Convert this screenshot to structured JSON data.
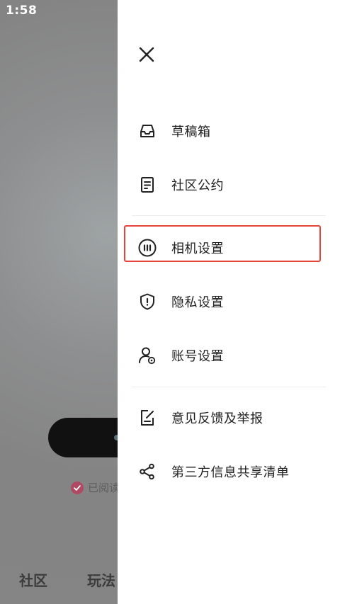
{
  "status_bar": {
    "time": "1:58"
  },
  "background_screen": {
    "agree_text": "已阅读",
    "tabs": [
      "社区",
      "玩法"
    ]
  },
  "drawer": {
    "close_icon": "close-icon",
    "menu_groups": [
      {
        "items": [
          {
            "label": "草稿箱",
            "icon": "inbox-icon"
          },
          {
            "label": "社区公约",
            "icon": "document-icon"
          }
        ]
      },
      {
        "items": [
          {
            "label": "相机设置",
            "icon": "camera-dots-icon",
            "highlighted": true
          },
          {
            "label": "隐私设置",
            "icon": "shield-icon"
          },
          {
            "label": "账号设置",
            "icon": "account-settings-icon"
          }
        ]
      },
      {
        "items": [
          {
            "label": "意见反馈及举报",
            "icon": "feedback-edit-icon"
          },
          {
            "label": "第三方信息共享清单",
            "icon": "share-icon"
          }
        ]
      }
    ],
    "highlight_color": "#e8433a"
  }
}
